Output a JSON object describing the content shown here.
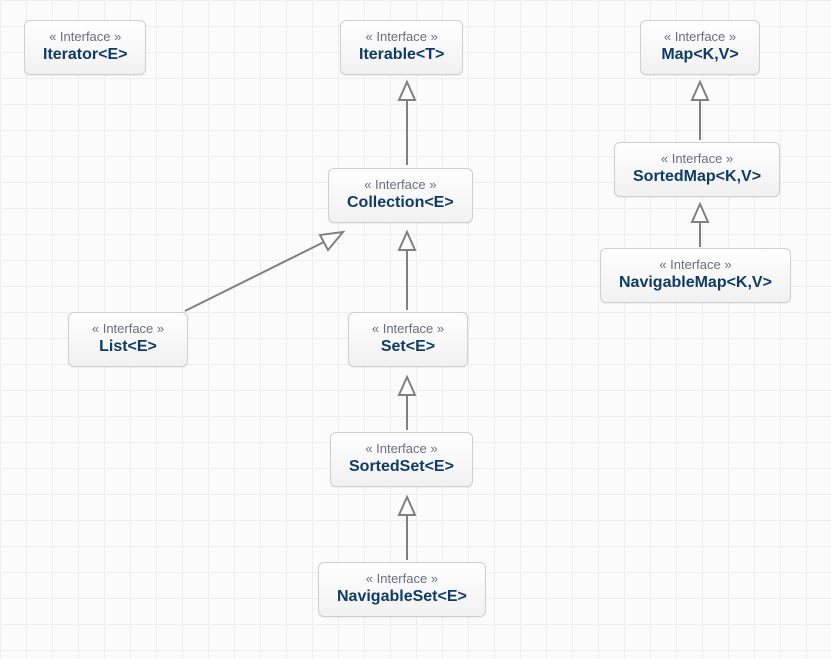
{
  "nodes": {
    "iterator": {
      "stereotype": "« Interface »",
      "name": "Iterator<E>"
    },
    "iterable": {
      "stereotype": "« Interface »",
      "name": "Iterable<T>"
    },
    "map": {
      "stereotype": "« Interface »",
      "name": "Map<K,V>"
    },
    "collection": {
      "stereotype": "« Interface »",
      "name": "Collection<E>"
    },
    "sortedmap": {
      "stereotype": "« Interface »",
      "name": "SortedMap<K,V>"
    },
    "navigablemap": {
      "stereotype": "« Interface »",
      "name": "NavigableMap<K,V>"
    },
    "list": {
      "stereotype": "« Interface »",
      "name": "List<E>"
    },
    "set": {
      "stereotype": "« Interface »",
      "name": "Set<E>"
    },
    "sortedset": {
      "stereotype": "« Interface »",
      "name": "SortedSet<E>"
    },
    "navigableset": {
      "stereotype": "« Interface »",
      "name": "NavigableSet<E>"
    }
  },
  "relationships": [
    {
      "from": "collection",
      "to": "iterable",
      "type": "generalization"
    },
    {
      "from": "list",
      "to": "collection",
      "type": "generalization"
    },
    {
      "from": "set",
      "to": "collection",
      "type": "generalization"
    },
    {
      "from": "sortedset",
      "to": "set",
      "type": "generalization"
    },
    {
      "from": "navigableset",
      "to": "sortedset",
      "type": "generalization"
    },
    {
      "from": "sortedmap",
      "to": "map",
      "type": "generalization"
    },
    {
      "from": "navigablemap",
      "to": "sortedmap",
      "type": "generalization"
    }
  ]
}
